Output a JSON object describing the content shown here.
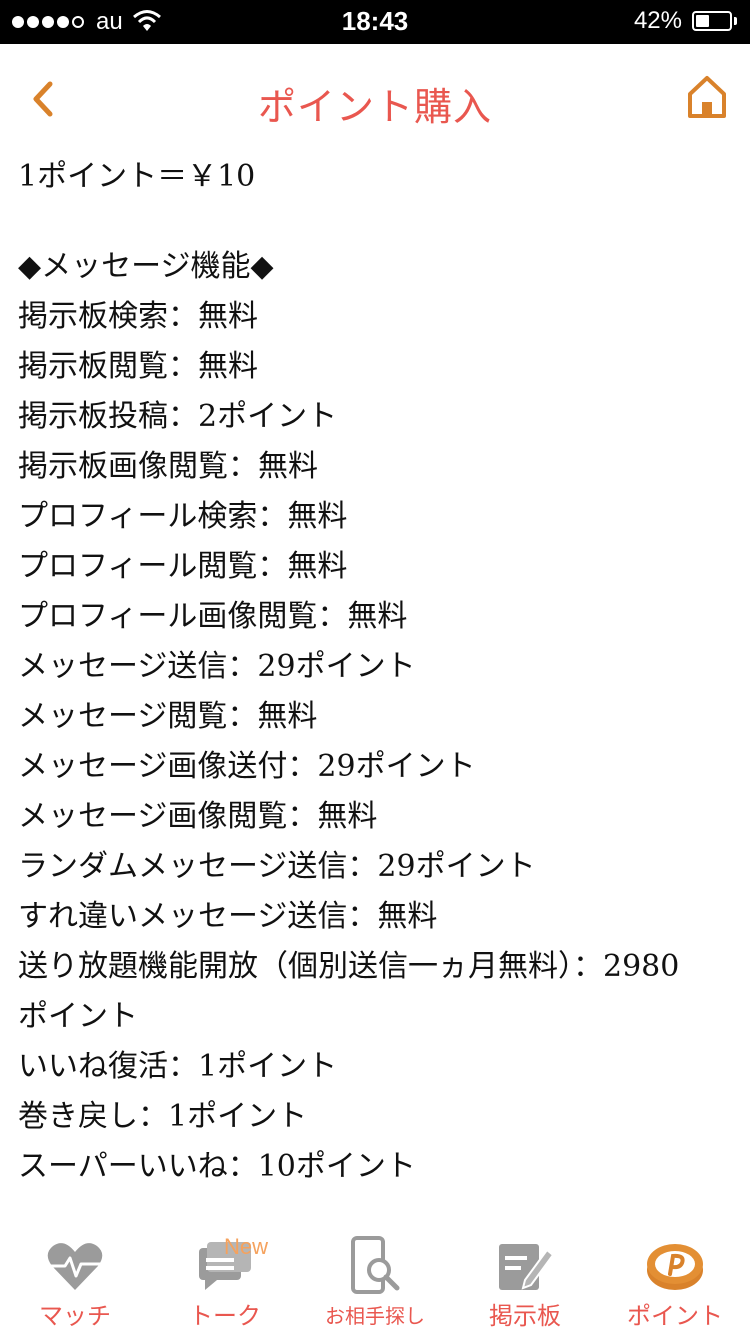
{
  "status_bar": {
    "carrier": "au",
    "time": "18:43",
    "battery_percent": "42%",
    "battery_level": 0.42
  },
  "nav": {
    "title": "ポイント購入",
    "accent_color": "#e9574f",
    "icon_color": "#d9822b",
    "back_icon": "chevron-left-icon",
    "home_icon": "home-icon"
  },
  "content": {
    "lines": [
      "1ポイント＝￥10",
      "",
      "◆メッセージ機能◆",
      "掲示板検索：無料",
      "掲示板閲覧：無料",
      "掲示板投稿：2ポイント",
      "掲示板画像閲覧：無料",
      "プロフィール検索：無料",
      "プロフィール閲覧：無料",
      "プロフィール画像閲覧：無料",
      "メッセージ送信：29ポイント",
      "メッセージ閲覧：無料",
      "メッセージ画像送付：29ポイント",
      "メッセージ画像閲覧：無料",
      "ランダムメッセージ送信：29ポイント",
      "すれ違いメッセージ送信：無料",
      "送り放題機能開放（個別送信一ヵ月無料）：2980",
      "ポイント",
      "いいね復活：1ポイント",
      "巻き戻し：1ポイント",
      "スーパーいいね：10ポイント"
    ]
  },
  "tabs": [
    {
      "label": "マッチ",
      "icon": "heart-pulse-icon"
    },
    {
      "label": "トーク",
      "icon": "chat-bubbles-icon",
      "badge": "New"
    },
    {
      "label": "お相手探し",
      "icon": "phone-search-icon"
    },
    {
      "label": "掲示板",
      "icon": "board-edit-icon"
    },
    {
      "label": "ポイント",
      "icon": "point-coin-icon",
      "active": true
    }
  ],
  "colors": {
    "tab_icon_inactive": "#9b9b9b",
    "tab_icon_active": "#d9822b",
    "new_badge": "#f5a25d"
  }
}
